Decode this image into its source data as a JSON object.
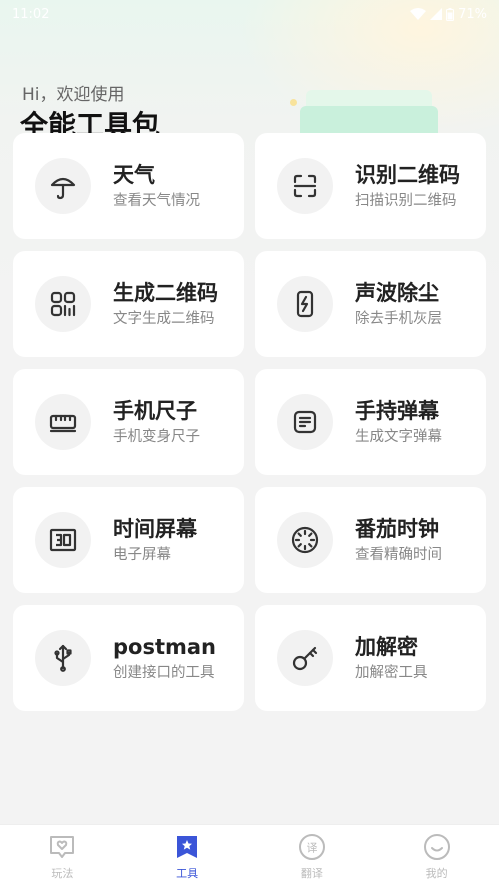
{
  "status_bar": {
    "time": "11:02",
    "battery": "71%"
  },
  "header": {
    "greeting": "Hi，欢迎使用",
    "title": "全能工具包"
  },
  "tools": [
    {
      "title": "天气",
      "subtitle": "查看天气情况",
      "icon": "umbrella-icon"
    },
    {
      "title": "识别二维码",
      "subtitle": "扫描识别二维码",
      "icon": "scan-icon"
    },
    {
      "title": "生成二维码",
      "subtitle": "文字生成二维码",
      "icon": "qrcode-icon"
    },
    {
      "title": "声波除尘",
      "subtitle": "除去手机灰层",
      "icon": "phone-bolt-icon"
    },
    {
      "title": "手机尺子",
      "subtitle": "手机变身尺子",
      "icon": "ruler-icon"
    },
    {
      "title": "手持弹幕",
      "subtitle": "生成文字弹幕",
      "icon": "barrage-icon"
    },
    {
      "title": "时间屏幕",
      "subtitle": "电子屏幕",
      "icon": "clock-30-icon"
    },
    {
      "title": "番茄时钟",
      "subtitle": "查看精确时间",
      "icon": "dial-icon"
    },
    {
      "title": "postman",
      "subtitle": "创建接口的工具",
      "icon": "usb-icon"
    },
    {
      "title": "加解密",
      "subtitle": "加解密工具",
      "icon": "key-icon"
    }
  ],
  "tabbar": [
    {
      "label": "玩法",
      "icon": "chat-heart-icon",
      "active": false
    },
    {
      "label": "工具",
      "icon": "star-bookmark-icon",
      "active": true
    },
    {
      "label": "翻译",
      "icon": "translate-icon",
      "active": false
    },
    {
      "label": "我的",
      "icon": "smile-icon",
      "active": false
    }
  ],
  "colors": {
    "accent": "#3b55d8",
    "icon": "#333333",
    "inactive": "#bbbbbb"
  }
}
